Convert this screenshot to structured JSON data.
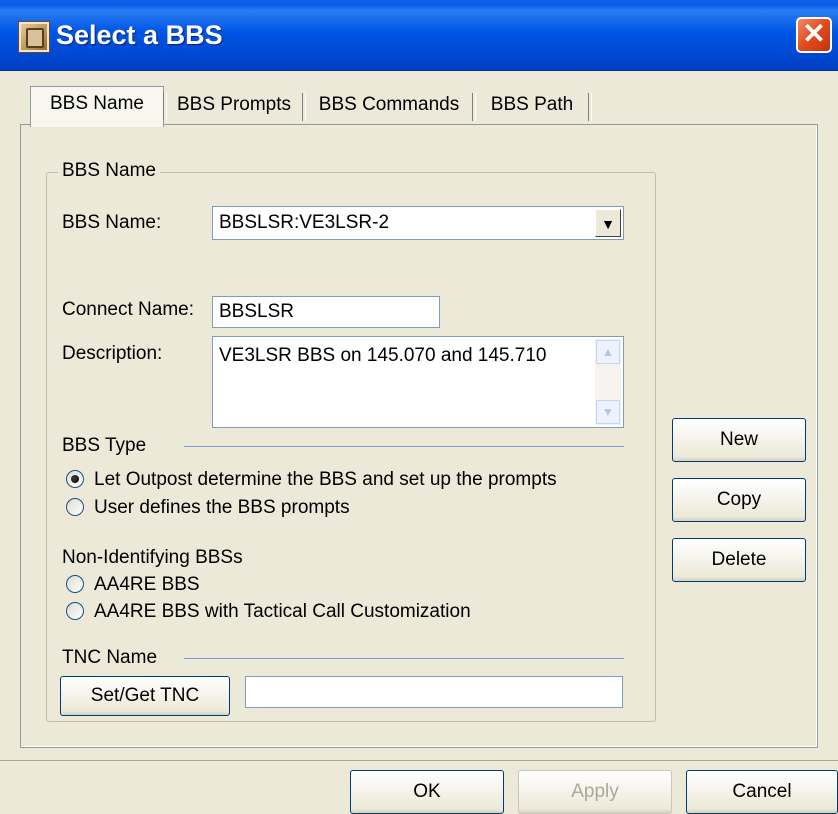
{
  "window": {
    "title": "Select a BBS",
    "close_glyph": "✕",
    "icon": "app-icon"
  },
  "tabs": [
    {
      "label": "BBS Name",
      "active": true
    },
    {
      "label": "BBS Prompts",
      "active": false
    },
    {
      "label": "BBS Commands",
      "active": false
    },
    {
      "label": "BBS Path",
      "active": false
    }
  ],
  "group": {
    "title": "BBS Name"
  },
  "form": {
    "bbs_name_label": "BBS Name:",
    "bbs_name_value": "BBSLSR:VE3LSR-2",
    "connect_name_label": "Connect Name:",
    "connect_name_value": "BBSLSR",
    "description_label": "Description:",
    "description_value": "VE3LSR BBS on 145.070 and 145.710"
  },
  "bbs_type": {
    "title": "BBS Type",
    "options": [
      {
        "label": "Let Outpost determine the BBS and set up the prompts",
        "checked": true
      },
      {
        "label": "User defines the BBS prompts",
        "checked": false
      }
    ]
  },
  "non_identifying": {
    "title": "Non-Identifying BBSs",
    "options": [
      {
        "label": "AA4RE BBS",
        "checked": false
      },
      {
        "label": "AA4RE BBS with Tactical Call Customization",
        "checked": false
      }
    ]
  },
  "tnc": {
    "title": "TNC Name",
    "button_label": "Set/Get TNC",
    "value": ""
  },
  "side_buttons": {
    "new": "New",
    "copy": "Copy",
    "delete": "Delete"
  },
  "footer": {
    "ok": "OK",
    "apply": "Apply",
    "cancel": "Cancel"
  },
  "colors": {
    "title_bar": "#0054e3",
    "close_button": "#e04a1e",
    "dialog_bg": "#ece9d8",
    "section_line": "#7a9cd8"
  }
}
